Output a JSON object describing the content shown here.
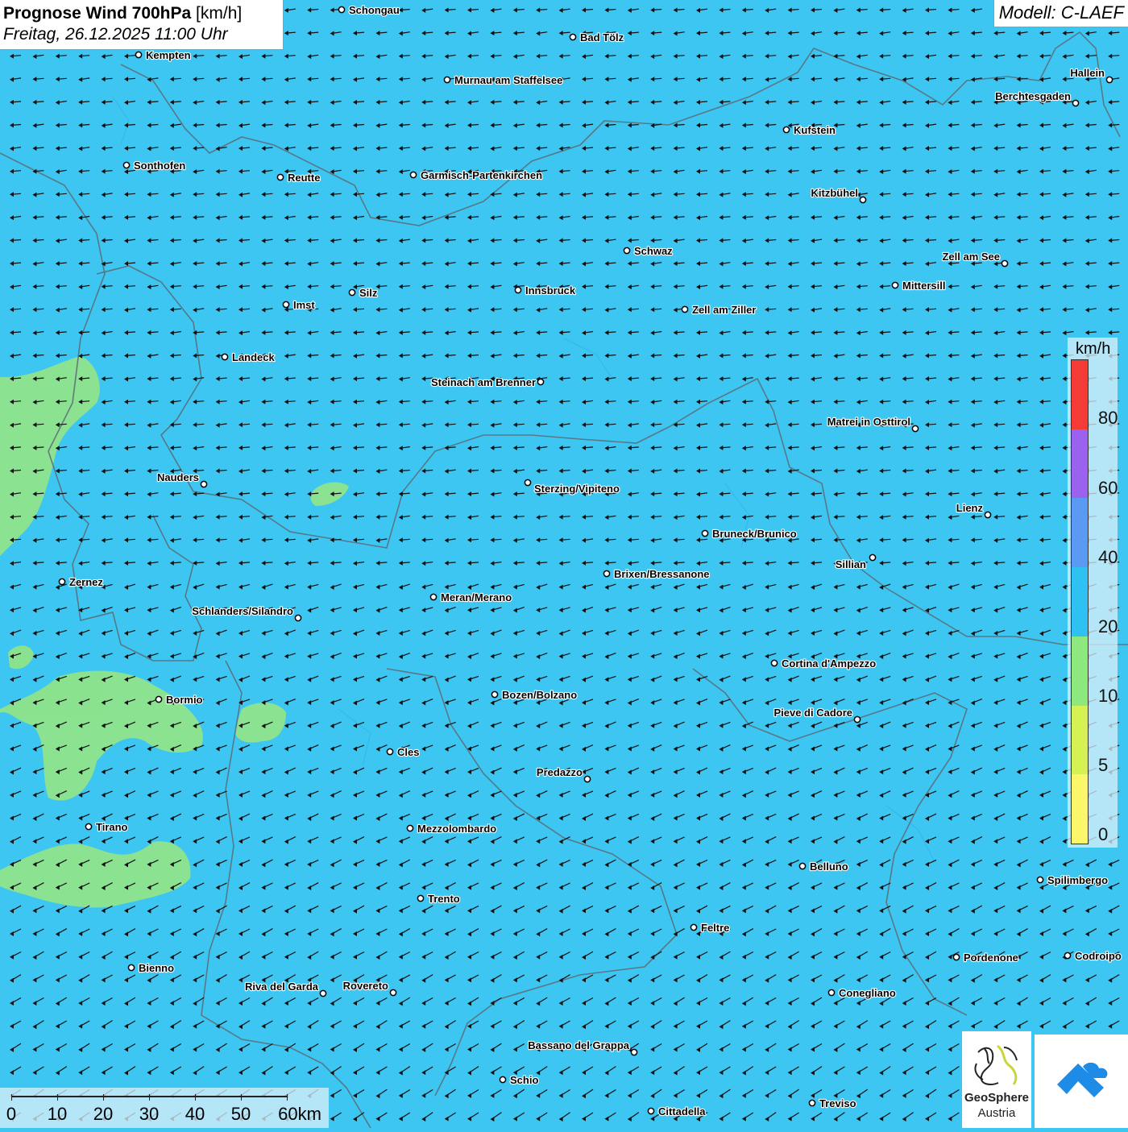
{
  "header": {
    "title": "Prognose Wind 700hPa",
    "unit": "[km/h]",
    "datetime": "Freitag, 26.12.2025 11:00 Uhr",
    "model": "Modell: C-LAEF"
  },
  "legend": {
    "unit": "km/h",
    "labels": [
      "80",
      "60",
      "40",
      "20",
      "10",
      "5",
      "0"
    ],
    "colors": [
      "#f43b35",
      "#9a62ee",
      "#5b9af2",
      "#2ec1f2",
      "#8de87e",
      "#d6f154",
      "#fbf66a"
    ]
  },
  "scalebar": {
    "labels": [
      "0",
      "10",
      "20",
      "30",
      "40",
      "50",
      "60km"
    ]
  },
  "logos": {
    "geosphere_line1": "GeoSphere",
    "geosphere_line2": "Austria"
  },
  "colors": {
    "background": "#3ec6f2",
    "low_wind": "#8fe48a",
    "border": "#666666"
  },
  "cities": [
    {
      "name": "Schongau"
    },
    {
      "name": "Bad Tölz"
    },
    {
      "name": "Kempten"
    },
    {
      "name": "Murnau am Staffelsee"
    },
    {
      "name": "Hallein"
    },
    {
      "name": "Berchtesgaden"
    },
    {
      "name": "Kufstein"
    },
    {
      "name": "Sonthofen"
    },
    {
      "name": "Reutte"
    },
    {
      "name": "Garmisch-Partenkirchen"
    },
    {
      "name": "Kitzbühel"
    },
    {
      "name": "Schwaz"
    },
    {
      "name": "Zell am See"
    },
    {
      "name": "Mittersill"
    },
    {
      "name": "Innsbruck"
    },
    {
      "name": "Silz"
    },
    {
      "name": "Imst"
    },
    {
      "name": "Zell am Ziller"
    },
    {
      "name": "Landeck"
    },
    {
      "name": "Steinach am Brenner"
    },
    {
      "name": "Matrei in Osttirol"
    },
    {
      "name": "Nauders"
    },
    {
      "name": "Sterzing/Vipiteno"
    },
    {
      "name": "Lienz"
    },
    {
      "name": "Bruneck/Brunico"
    },
    {
      "name": "Sillian"
    },
    {
      "name": "Zernez"
    },
    {
      "name": "Brixen/Bressanone"
    },
    {
      "name": "Meran/Merano"
    },
    {
      "name": "Schlanders/Silandro"
    },
    {
      "name": "Cortina d'Ampezzo"
    },
    {
      "name": "Bozen/Bolzano"
    },
    {
      "name": "Bormio"
    },
    {
      "name": "Pieve di Cadore"
    },
    {
      "name": "Cles"
    },
    {
      "name": "Predazzo"
    },
    {
      "name": "Tirano"
    },
    {
      "name": "Mezzolombardo"
    },
    {
      "name": "Belluno"
    },
    {
      "name": "Spilimbergo"
    },
    {
      "name": "Trento"
    },
    {
      "name": "Feltre"
    },
    {
      "name": "Pordenone"
    },
    {
      "name": "Codroipo"
    },
    {
      "name": "Bienno"
    },
    {
      "name": "Riva del Garda"
    },
    {
      "name": "Rovereto"
    },
    {
      "name": "Conegliano"
    },
    {
      "name": "Bassano del Grappa"
    },
    {
      "name": "Schio"
    },
    {
      "name": "Treviso"
    },
    {
      "name": "Cittadella"
    }
  ]
}
